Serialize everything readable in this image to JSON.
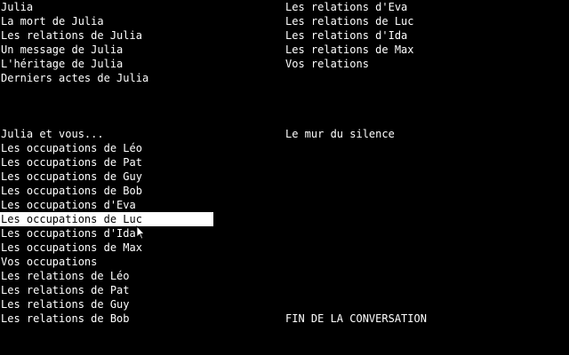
{
  "menu": {
    "left_top": [
      "Julia",
      "La mort de Julia",
      "Les relations de Julia",
      "Un message de Julia",
      "L'héritage de Julia",
      "Derniers actes de Julia"
    ],
    "right_top": [
      "Les relations d'Eva",
      "Les relations de Luc",
      "Les relations d'Ida",
      "Les relations de Max",
      "Vos relations"
    ],
    "left_mid": [
      "Julia et vous...",
      "Les occupations de Léo",
      "Les occupations de Pat",
      "Les occupations de Guy",
      "Les occupations de Bob",
      "Les occupations d'Eva",
      "Les occupations de Luc",
      "Les occupations d'Ida",
      "Les occupations de Max",
      "Vos occupations",
      "Les relations de Léo",
      "Les relations de Pat",
      "Les relations de Guy",
      "Les relations de Bob"
    ],
    "right_mid": [
      "Le mur du silence"
    ],
    "end": "FIN DE LA CONVERSATION",
    "selected": "Les occupations de Luc"
  },
  "colors": {
    "background": "#000000",
    "text": "#ffffff",
    "highlight_bg": "#ffffff",
    "highlight_text": "#000000"
  },
  "cursor_icon": "arrow-pointer-icon"
}
